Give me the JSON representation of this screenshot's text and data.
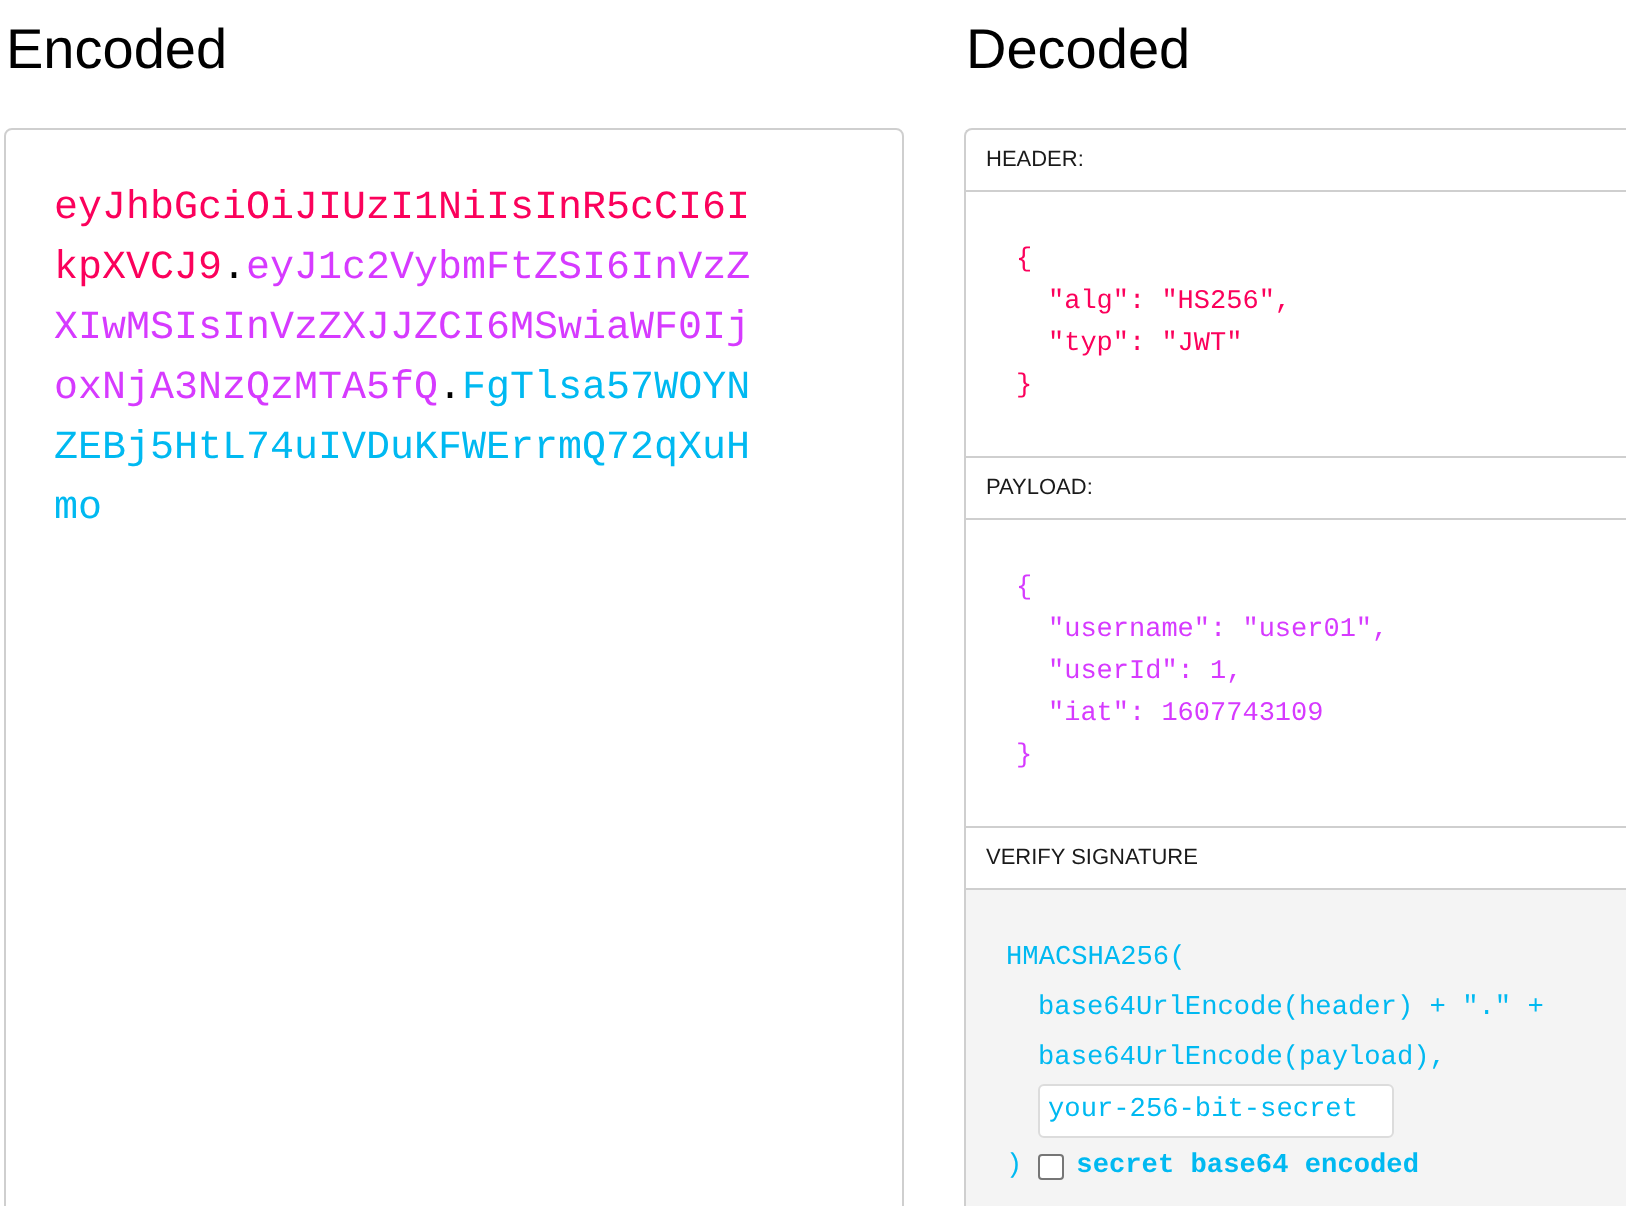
{
  "encoded": {
    "title": "Encoded",
    "token_parts": [
      {
        "text": "eyJhbGciOiJIUzI1NiIsInR5cCI6IkpXVCJ9",
        "color": "#fb015b"
      },
      {
        "text": ".",
        "color": "#000000"
      },
      {
        "text": "eyJ1c2VybmFtZSI6InVzZXIwMSIsInVzZXJJZCI6MSwiaWF0IjoxNjA3NzQzMTA5fQ",
        "color": "#d63aff"
      },
      {
        "text": ".",
        "color": "#000000"
      },
      {
        "text": "FgTlsa57WOYNZEBj5HtL74uIVDuKFWErrmQ72qXuHmo",
        "color": "#00b9f1"
      }
    ]
  },
  "decoded": {
    "title": "Decoded",
    "sections": [
      {
        "kind": "json",
        "label": "HEADER:",
        "color": "#fb015b",
        "open": "{",
        "entries": [
          "\"alg\": \"HS256\",",
          "\"typ\": \"JWT\""
        ],
        "close": "}"
      },
      {
        "kind": "json",
        "label": "PAYLOAD:",
        "color": "#d63aff",
        "open": "{",
        "entries": [
          "\"username\": \"user01\",",
          "\"userId\": 1,",
          "\"iat\": 1607743109"
        ],
        "close": "}"
      },
      {
        "kind": "signature",
        "label": "VERIFY SIGNATURE",
        "color": "#00b9f1",
        "call": "HMACSHA256(",
        "arguments": [
          "base64UrlEncode(header) + \".\" +",
          "base64UrlEncode(payload),"
        ],
        "secret": {
          "value": "your-256-bit-secret"
        },
        "close": ")",
        "base64_option": {
          "label": "secret base64 encoded",
          "checked": false
        }
      }
    ]
  }
}
